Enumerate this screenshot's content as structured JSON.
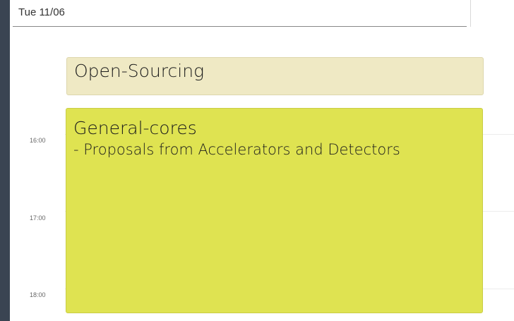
{
  "header": {
    "date": "Tue 11/06"
  },
  "time_labels": [
    "16:00",
    "17:00",
    "18:00"
  ],
  "events": [
    {
      "title": "Open-Sourcing",
      "description": "",
      "color": "#efe9c4"
    },
    {
      "title": "General-cores",
      "description": "- Proposals from Accelerators and Detectors",
      "color": "#dfe351"
    }
  ]
}
